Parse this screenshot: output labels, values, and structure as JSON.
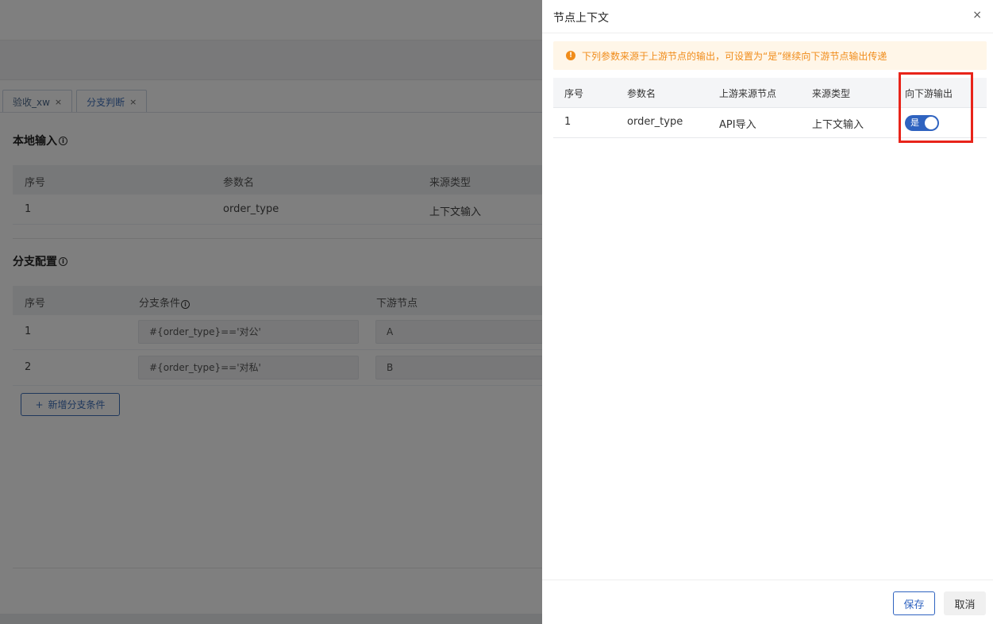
{
  "background": {
    "tabs": [
      {
        "label": "验收_xw",
        "close": "×"
      },
      {
        "label": "分支判断",
        "close": "×"
      }
    ],
    "local_input": {
      "title": "本地输入",
      "columns": [
        "序号",
        "参数名",
        "来源类型"
      ],
      "rows": [
        {
          "index": "1",
          "name": "order_type",
          "source_type": "上下文输入"
        }
      ]
    },
    "branch_config": {
      "title": "分支配置",
      "columns": [
        "序号",
        "分支条件",
        "下游节点"
      ],
      "rows": [
        {
          "index": "1",
          "condition": "#{order_type}=='对公'",
          "node": "A"
        },
        {
          "index": "2",
          "condition": "#{order_type}=='对私'",
          "node": "B"
        }
      ],
      "add_button": "新增分支条件"
    }
  },
  "drawer": {
    "title": "节点上下文",
    "close": "×",
    "notice": "下列参数来源于上游节点的输出，可设置为“是”继续向下游节点输出传递",
    "columns": [
      "序号",
      "参数名",
      "上游来源节点",
      "来源类型",
      "向下游输出"
    ],
    "rows": [
      {
        "index": "1",
        "name": "order_type",
        "upstream_node": "API导入",
        "source_type": "上下文输入",
        "output_label": "是",
        "output_on": true
      }
    ],
    "save_label": "保存",
    "cancel_label": "取消"
  },
  "colors": {
    "accent": "#2f63c0",
    "warning": "#f08c1a",
    "highlight": "#e8241a"
  }
}
